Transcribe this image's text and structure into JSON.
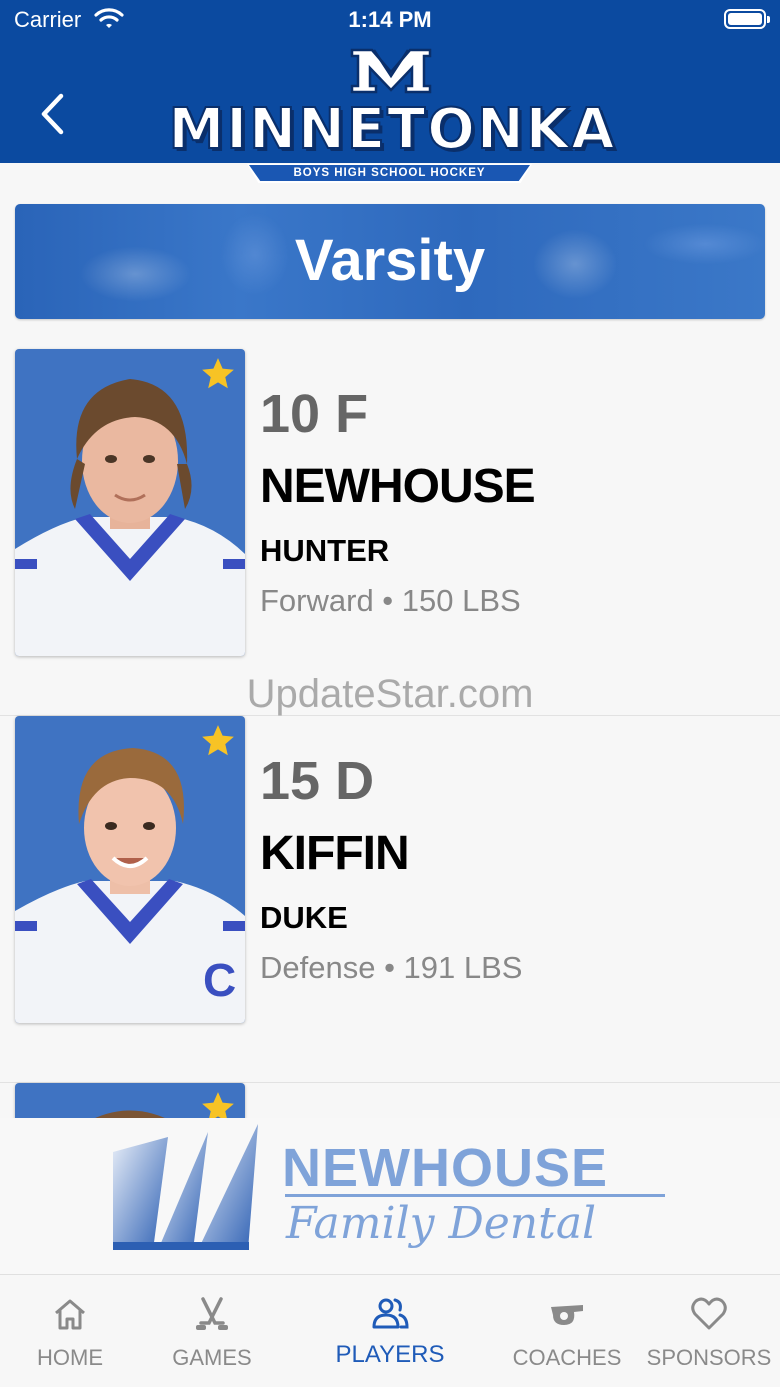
{
  "status_bar": {
    "carrier": "Carrier",
    "time": "1:14 PM"
  },
  "header": {
    "logo_wordmark": "MINNETONKA",
    "logo_ribbon": "BOYS HIGH SCHOOL HOCKEY",
    "back_icon": "chevron-left-icon"
  },
  "banner": {
    "title": "Varsity"
  },
  "players": [
    {
      "number_position": "10 F",
      "last_name": "NEWHOUSE",
      "first_name": "HUNTER",
      "detail": "Forward • 150 LBS",
      "captain_star": true
    },
    {
      "number_position": "15 D",
      "last_name": "KIFFIN",
      "first_name": "DUKE",
      "detail": "Defense • 191 LBS",
      "captain_star": true
    },
    {
      "captain_star": true
    }
  ],
  "watermark": "UpdateStar.com",
  "sponsor": {
    "name": "NEWHOUSE",
    "tagline": "Family Dental"
  },
  "tabs": [
    {
      "label": "HOME",
      "icon": "home-icon",
      "active": false
    },
    {
      "label": "GAMES",
      "icon": "hockey-sticks-icon",
      "active": false
    },
    {
      "label": "PLAYERS",
      "icon": "players-icon",
      "active": true
    },
    {
      "label": "COACHES",
      "icon": "whistle-icon",
      "active": false
    },
    {
      "label": "SPONSORS",
      "icon": "heart-icon",
      "active": false
    }
  ],
  "colors": {
    "header_blue": "#0b4aa0",
    "accent_blue": "#1f5bb8",
    "star_gold": "#f7c325",
    "sponsor_blue": "#7fa3d9"
  }
}
